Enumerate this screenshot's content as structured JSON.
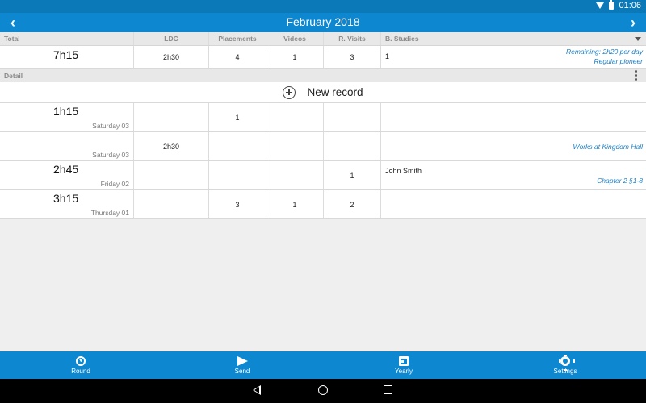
{
  "status": {
    "time": "01:06",
    "icons": [
      "wifi-icon",
      "battery-icon"
    ]
  },
  "header": {
    "title": "February 2018"
  },
  "columns": {
    "total": "Total",
    "ldc": "LDC",
    "placements": "Placements",
    "videos": "Videos",
    "rvisits": "R. Visits",
    "bstudies": "B. Studies"
  },
  "totals": {
    "time": "7h15",
    "ldc": "2h30",
    "placements": "4",
    "videos": "1",
    "rvisits": "3",
    "bstudies": "1",
    "remaining": "Remaining: 2h20 per day",
    "status": "Regular pioneer"
  },
  "detail_label": "Detail",
  "new_record": "New record",
  "records": [
    {
      "time": "1h15",
      "day": "Saturday 03",
      "ldc": "",
      "placements": "1",
      "videos": "",
      "rvisits": "",
      "bstudies": "",
      "note": ""
    },
    {
      "time": "",
      "day": "Saturday 03",
      "ldc": "2h30",
      "placements": "",
      "videos": "",
      "rvisits": "",
      "bstudies": "",
      "note": "Works at Kingdom Hall"
    },
    {
      "time": "2h45",
      "day": "Friday 02",
      "ldc": "",
      "placements": "",
      "videos": "",
      "rvisits": "1",
      "bstudies": "John Smith",
      "note": "Chapter 2 §1-8"
    },
    {
      "time": "3h15",
      "day": "Thursday 01",
      "ldc": "",
      "placements": "3",
      "videos": "1",
      "rvisits": "2",
      "bstudies": "",
      "note": ""
    }
  ],
  "bottom_nav": [
    {
      "label": "Round",
      "icon": "stopwatch-icon"
    },
    {
      "label": "Send",
      "icon": "send-icon"
    },
    {
      "label": "Yearly",
      "icon": "calendar-icon"
    },
    {
      "label": "Settings",
      "icon": "gear-icon"
    }
  ],
  "colors": {
    "accent": "#0c87d0",
    "statusbar": "#0b78b8",
    "note": "#1a7fc4"
  }
}
